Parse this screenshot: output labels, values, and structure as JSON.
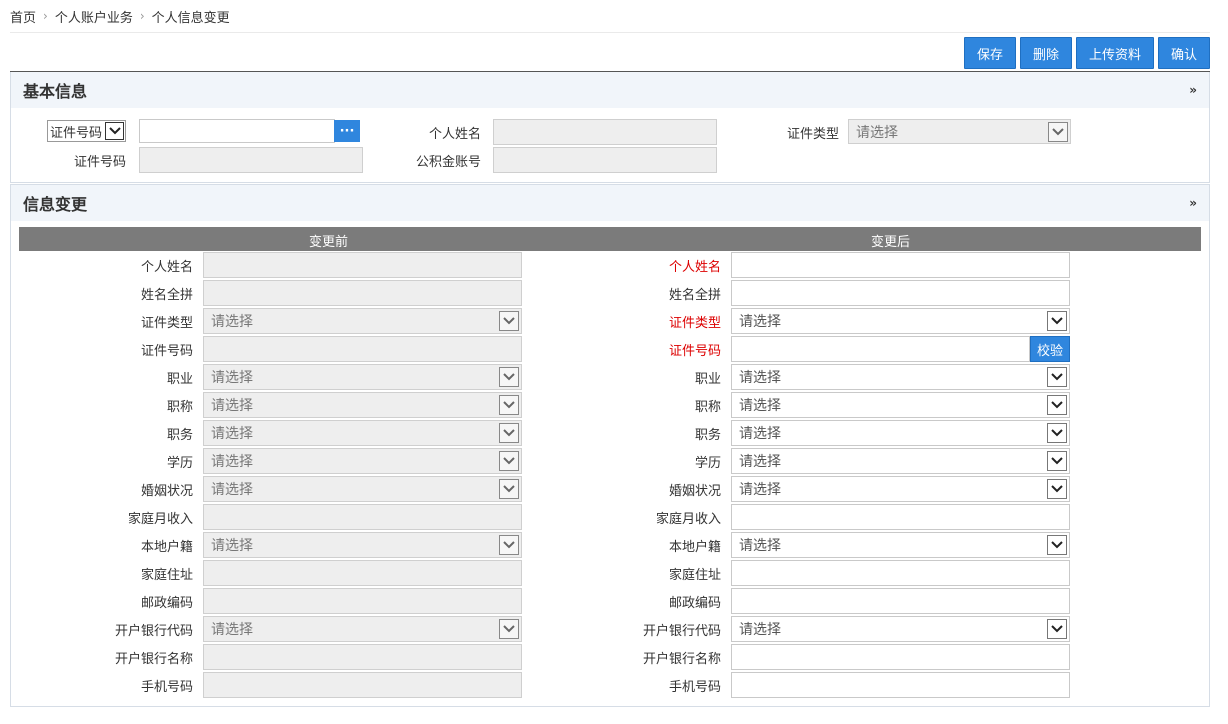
{
  "breadcrumb": {
    "home": "首页",
    "level1": "个人账户业务",
    "level2": "个人信息变更"
  },
  "toolbar": {
    "save": "保存",
    "delete": "删除",
    "upload": "上传资料",
    "confirm": "确认"
  },
  "basic": {
    "title": "基本信息",
    "id_type_selector_value": "证件号码",
    "id_search_value": "",
    "name_label": "个人姓名",
    "id_type_label": "证件类型",
    "id_type_value": "请选择",
    "id_number_label": "证件号码",
    "fund_account_label": "公积金账号"
  },
  "change": {
    "title": "信息变更",
    "before_header": "变更前",
    "after_header": "变更后",
    "verify_button": "校验",
    "placeholder_select": "请选择",
    "rows": [
      {
        "label": "个人姓名",
        "type": "text",
        "required": true
      },
      {
        "label": "姓名全拼",
        "type": "text",
        "required": false
      },
      {
        "label": "证件类型",
        "type": "select",
        "required": true
      },
      {
        "label": "证件号码",
        "type": "text",
        "required": true,
        "verify": true
      },
      {
        "label": "职业",
        "type": "select",
        "required": false
      },
      {
        "label": "职称",
        "type": "select",
        "required": false
      },
      {
        "label": "职务",
        "type": "select",
        "required": false
      },
      {
        "label": "学历",
        "type": "select",
        "required": false
      },
      {
        "label": "婚姻状况",
        "type": "select",
        "required": false
      },
      {
        "label": "家庭月收入",
        "type": "text",
        "required": false
      },
      {
        "label": "本地户籍",
        "type": "select",
        "required": false
      },
      {
        "label": "家庭住址",
        "type": "text",
        "required": false
      },
      {
        "label": "邮政编码",
        "type": "text",
        "required": false
      },
      {
        "label": "开户银行代码",
        "type": "select",
        "required": false
      },
      {
        "label": "开户银行名称",
        "type": "text",
        "required": false
      },
      {
        "label": "手机号码",
        "type": "text",
        "required": false
      }
    ]
  }
}
